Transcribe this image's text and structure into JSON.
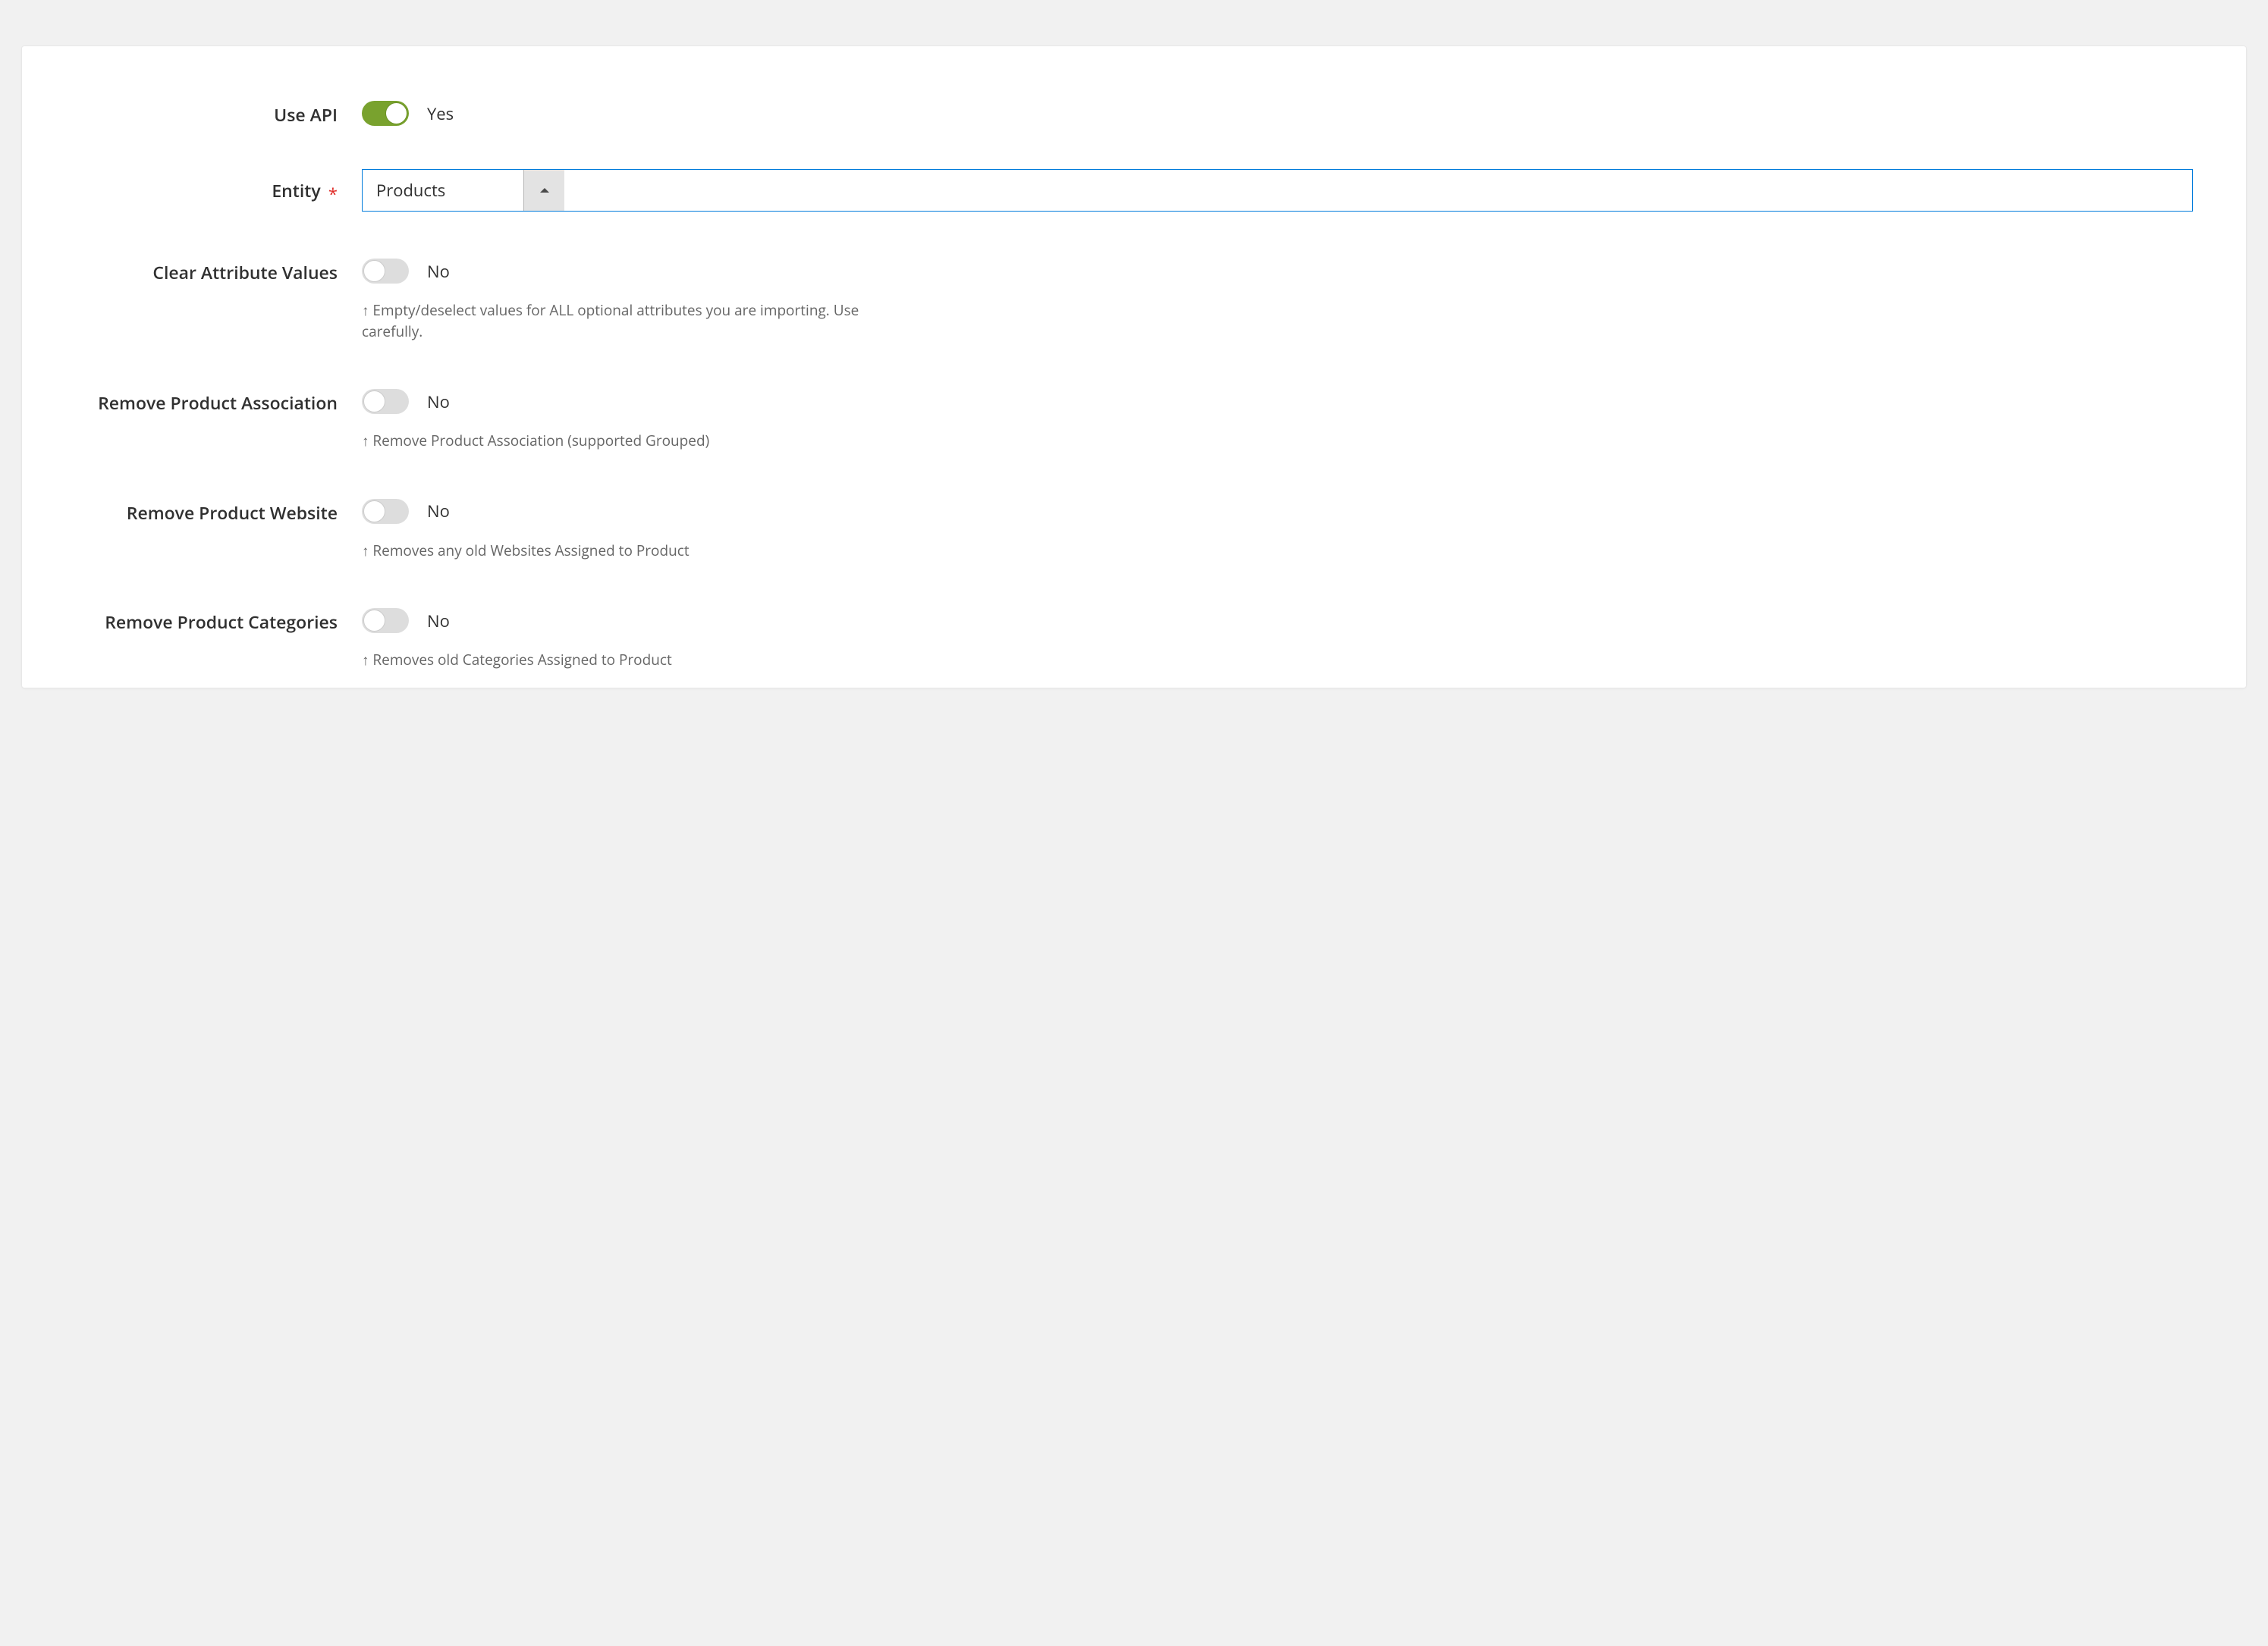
{
  "fields": {
    "use_api": {
      "label": "Use API",
      "state": "Yes",
      "on": true
    },
    "entity": {
      "label": "Entity",
      "required": "*",
      "value": "Products"
    },
    "clear_attr": {
      "label": "Clear Attribute Values",
      "state": "No",
      "on": false,
      "help": "↑ Empty/deselect values for ALL optional attributes you are importing. Use carefully."
    },
    "remove_assoc": {
      "label": "Remove Product Association",
      "state": "No",
      "on": false,
      "help": "↑ Remove Product Association (supported Grouped)"
    },
    "remove_website": {
      "label": "Remove Product Website",
      "state": "No",
      "on": false,
      "help": "↑ Removes any old Websites Assigned to Product"
    },
    "remove_categories": {
      "label": "Remove Product Categories",
      "state": "No",
      "on": false,
      "help": "↑ Removes old Categories Assigned to Product"
    }
  }
}
